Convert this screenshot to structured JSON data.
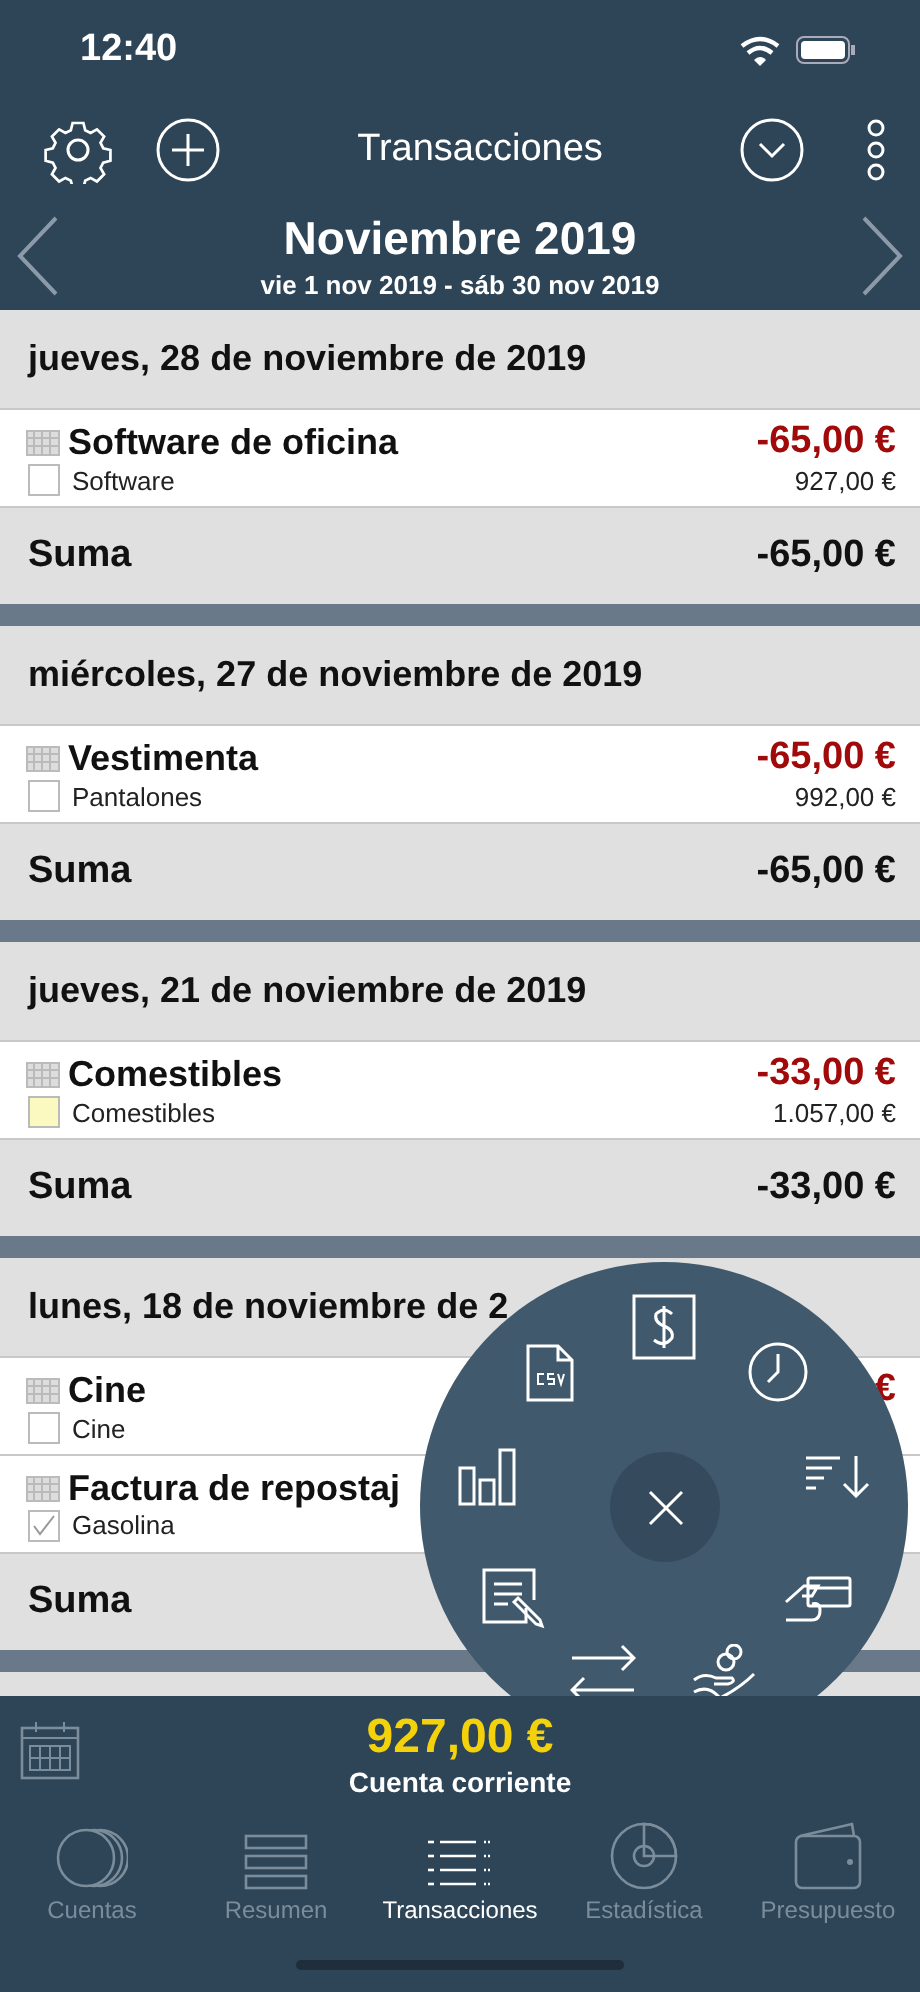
{
  "status_bar": {
    "time": "12:40"
  },
  "nav": {
    "title": "Transacciones"
  },
  "period": {
    "title": "Noviembre 2019",
    "range": "vie 1 nov 2019 - sáb 30 nov 2019"
  },
  "days": [
    {
      "date": "jueves, 28 de noviembre de 2019",
      "transactions": [
        {
          "title": "Software de oficina",
          "category": "Software",
          "amount": "-65,00 €",
          "balance": "927,00 €",
          "checked": false,
          "color": "#ffffff"
        }
      ],
      "sum_label": "Suma",
      "sum": "-65,00 €"
    },
    {
      "date": "miércoles, 27 de noviembre de 2019",
      "transactions": [
        {
          "title": "Vestimenta",
          "category": "Pantalones",
          "amount": "-65,00 €",
          "balance": "992,00 €",
          "checked": false,
          "color": "#ffffff"
        }
      ],
      "sum_label": "Suma",
      "sum": "-65,00 €"
    },
    {
      "date": "jueves, 21 de noviembre de 2019",
      "transactions": [
        {
          "title": "Comestibles",
          "category": "Comestibles",
          "amount": "-33,00 €",
          "balance": "1.057,00 €",
          "checked": false,
          "color": "#fbf8c0"
        }
      ],
      "sum_label": "Suma",
      "sum": "-33,00 €"
    },
    {
      "date": "lunes, 18 de noviembre de 2",
      "transactions": [
        {
          "title": "Cine",
          "category": "Cine",
          "amount": "€",
          "checked": false,
          "color": "#ffffff"
        },
        {
          "title": "Factura de repostaj",
          "category": "Gasolina",
          "checked": true,
          "color": "#ffffff"
        }
      ],
      "sum_label": "Suma"
    }
  ],
  "account": {
    "balance": "927,00 €",
    "name": "Cuenta corriente"
  },
  "tabs": [
    {
      "label": "Cuentas",
      "selected": false
    },
    {
      "label": "Resumen",
      "selected": false
    },
    {
      "label": "Transacciones",
      "selected": true
    },
    {
      "label": "Estadística",
      "selected": false
    },
    {
      "label": "Presupuesto",
      "selected": false
    }
  ]
}
